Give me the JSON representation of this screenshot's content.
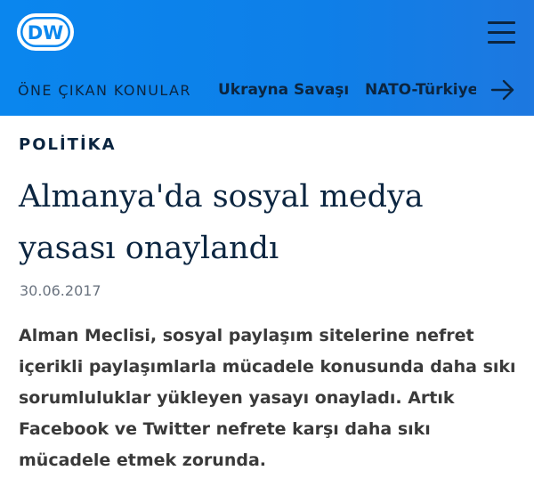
{
  "header": {
    "logo_text": "DW",
    "menu_icon": "hamburger-menu-icon",
    "topics_label": "ÖNE ÇIKAN KONULAR",
    "topics": [
      {
        "label": "Ukrayna Savaşı"
      },
      {
        "label": "NATO-Türkiye"
      }
    ],
    "next_icon": "arrow-right-icon",
    "colors": {
      "header_bg": "#0a86ee",
      "text_dark": "#0b2540"
    }
  },
  "article": {
    "category": "POLİTİKA",
    "headline": "Almanya'da sosyal medya yasası onaylandı",
    "date": "30.06.2017",
    "lead": "Alman Meclisi, sosyal paylaşım sitelerine nefret içerikli paylaşımlarla mücadele konusunda daha sıkı sorumluluklar yükleyen yasayı onayladı. Artık Facebook ve Twitter nefrete karşı daha sıkı mücadele etmek zorunda."
  }
}
